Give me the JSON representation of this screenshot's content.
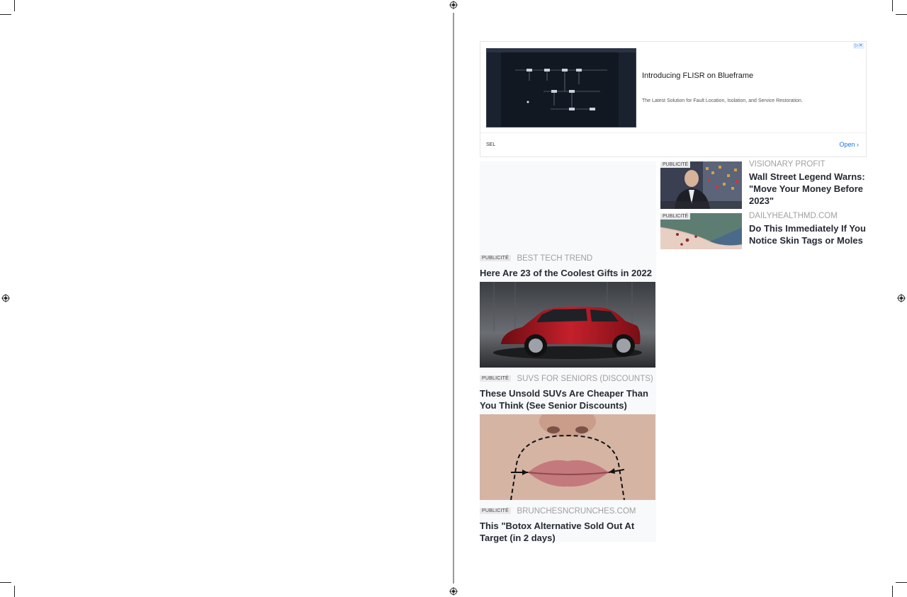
{
  "top_ad": {
    "headline": "Introducing FLISR on Blueframe",
    "description": "The Latest Solution for Fault Location, Isolation, and Service Restoration.",
    "advertiser": "SEL",
    "cta": "Open ›",
    "adchoices": "▷✕"
  },
  "sponsored": {
    "badge": "PUBLICITÉ",
    "left": [
      {
        "source": "BEST TECH TREND",
        "title": "Here Are 23 of the Coolest Gifts in 2022"
      },
      {
        "source": "SUVS FOR SENIORS (DISCOUNTS)",
        "title": "These Unsold SUVs Are Cheaper Than You Think (See Senior Discounts)"
      },
      {
        "source": "BRUNCHESNCRUNCHES.COM",
        "title": "This \"Botox Alternative Sold Out At Target (in 2 days)"
      }
    ],
    "right": [
      {
        "source": "VISIONARY PROFIT",
        "title": "Wall Street Legend Warns: \"Move Your Money Before 2023\""
      },
      {
        "source": "DAILYHEALTHMD.COM",
        "title": "Do This Immediately If You Notice Skin Tags or Moles"
      }
    ]
  }
}
